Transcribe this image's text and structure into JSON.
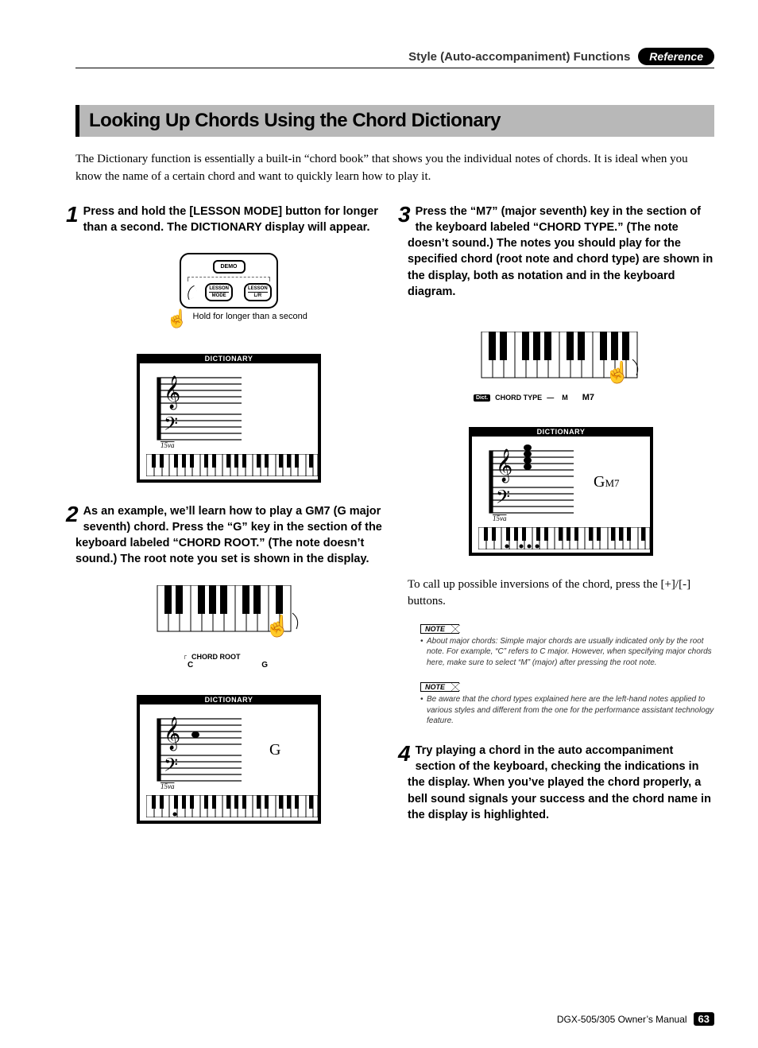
{
  "header": {
    "section": "Style (Auto-accompaniment) Functions",
    "badge": "Reference"
  },
  "title": "Looking Up Chords Using the Chord Dictionary",
  "intro": "The Dictionary function is essentially a built-in “chord book” that shows you the individual notes of chords. It is ideal when you know the name of a certain chord and want to quickly learn how to play it.",
  "steps": {
    "s1": {
      "num": "1",
      "text": "Press and hold the [LESSON MODE] button for longer than a second. The DICTIONARY display will appear."
    },
    "s2": {
      "num": "2",
      "text": "As an example, we’ll learn how to play a GM7 (G major seventh) chord. Press the “G” key in the section of the keyboard labeled “CHORD ROOT.” (The note doesn’t sound.) The root note you set is shown in the display."
    },
    "s3": {
      "num": "3",
      "text": "Press the “M7” (major seventh) key in the section of the keyboard labeled “CHORD TYPE.” (The note doesn’t sound.) The notes you should play for the specified chord (root note and chord type) are shown in the display, both as notation and in the keyboard diagram."
    },
    "s4": {
      "num": "4",
      "text": "Try playing a chord in the auto accompaniment section of the keyboard, checking the indications in the display. When you’ve played the chord properly, a bell sound signals your success and the chord name in the display is highlighted."
    }
  },
  "fig1": {
    "demo": "DEMO",
    "btn_left_top": "LESSON",
    "btn_left_bot": "MODE",
    "btn_right_top": "LESSON",
    "btn_right_bot": "L/R",
    "caption": "Hold for longer than a second",
    "dict_label": "DICTIONARY",
    "ottava": "15va"
  },
  "fig2": {
    "chord_root_label": "CHORD ROOT",
    "key_c": "C",
    "key_g": "G",
    "dict_label": "DICTIONARY",
    "display_chord": "G",
    "ottava": "15va"
  },
  "fig3": {
    "chord_type_label": "CHORD TYPE",
    "dash": "—",
    "m_label": "M",
    "m7_label": "M7",
    "dict_tag": "Dict.",
    "dict_label": "DICTIONARY",
    "display_chord": "G",
    "display_suffix": "M7",
    "ottava": "15va"
  },
  "post3": "To call up possible inversions of the chord, press the [+]/[-] buttons.",
  "note_label": "NOTE",
  "note1": "About major chords: Simple major chords are usually indicated only by the root note. For example, “C” refers to C major. However, when specifying major chords here, make sure to select “M” (major) after pressing the root note.",
  "note2": "Be aware that the chord types explained here are the left-hand notes applied to various styles and different from the one for the performance assistant technology feature.",
  "footer": {
    "manual": "DGX-505/305  Owner’s Manual",
    "page": "63"
  }
}
